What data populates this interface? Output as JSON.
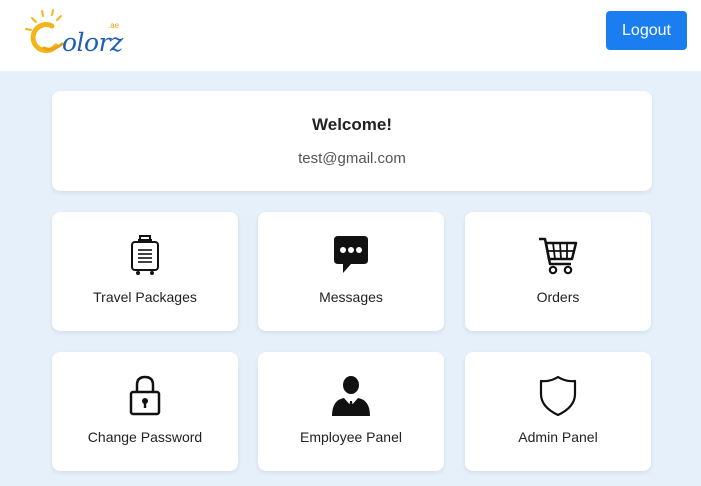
{
  "header": {
    "logo_text": "olorz",
    "logo_suffix": ".ae",
    "logout_label": "Logout"
  },
  "welcome": {
    "title": "Welcome!",
    "email": "test@gmail.com"
  },
  "tiles": [
    {
      "label": "Travel Packages",
      "icon": "luggage-icon"
    },
    {
      "label": "Messages",
      "icon": "chat-bubble-icon"
    },
    {
      "label": "Orders",
      "icon": "shopping-cart-icon"
    },
    {
      "label": "Change Password",
      "icon": "padlock-icon"
    },
    {
      "label": "Employee Panel",
      "icon": "employee-icon"
    },
    {
      "label": "Admin Panel",
      "icon": "shield-icon"
    }
  ],
  "colors": {
    "accent": "#1a7df0",
    "page_background": "#e6f0fb",
    "logo_blue": "#1d5fb8",
    "logo_sun": "#f2b61c"
  }
}
